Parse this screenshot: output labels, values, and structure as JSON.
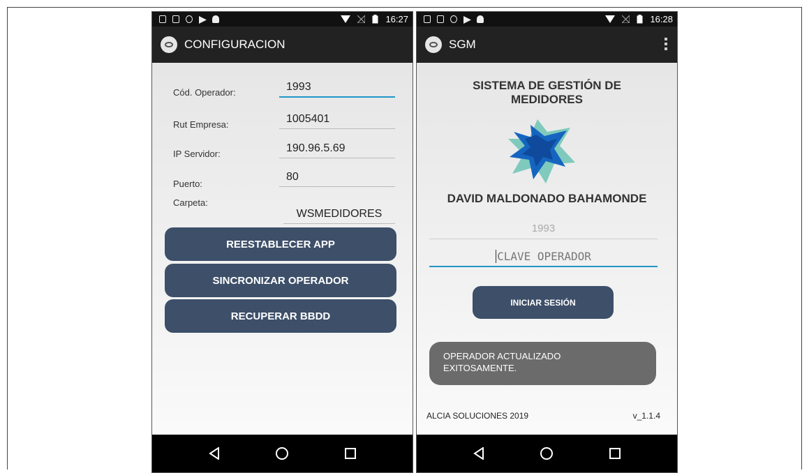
{
  "left": {
    "status": {
      "time": "16:27"
    },
    "appbar": {
      "title": "CONFIGURACION"
    },
    "fields": [
      {
        "label": "Cód. Operador:",
        "value": "1993"
      },
      {
        "label": "Rut Empresa:",
        "value": "1005401"
      },
      {
        "label": "IP Servidor:",
        "value": "190.96.5.69"
      },
      {
        "label": "Puerto:",
        "value": "80"
      },
      {
        "label": "Carpeta:",
        "value": "WSMEDIDORES"
      }
    ],
    "buttons": {
      "reset": "REESTABLECER APP",
      "sync": "SINCRONIZAR OPERADOR",
      "recover": "RECUPERAR BBDD"
    }
  },
  "right": {
    "status": {
      "time": "16:28"
    },
    "appbar": {
      "title": "SGM"
    },
    "title_line1": "SISTEMA DE GESTIÓN DE",
    "title_line2": "MEDIDORES",
    "operator_name": "DAVID  MALDONADO BAHAMONDE",
    "code_value": "1993",
    "password_placeholder": "CLAVE OPERADOR",
    "login_button": "INICIAR SESIÓN",
    "toast_line1": "OPERADOR ACTUALIZADO",
    "toast_line2": "EXITOSAMENTE.",
    "footer_company": "ALCIA SOLUCIONES 2019",
    "footer_version": "v_1.1.4"
  },
  "colors": {
    "button": "#3d4f69",
    "focus_underline": "#2196c8",
    "toast": "#6b6b6b",
    "logo_primary": "#1565c0",
    "logo_secondary": "#6cc4b4"
  },
  "icons": {
    "back": "back-icon",
    "home": "home-icon",
    "recents": "recents-icon"
  }
}
